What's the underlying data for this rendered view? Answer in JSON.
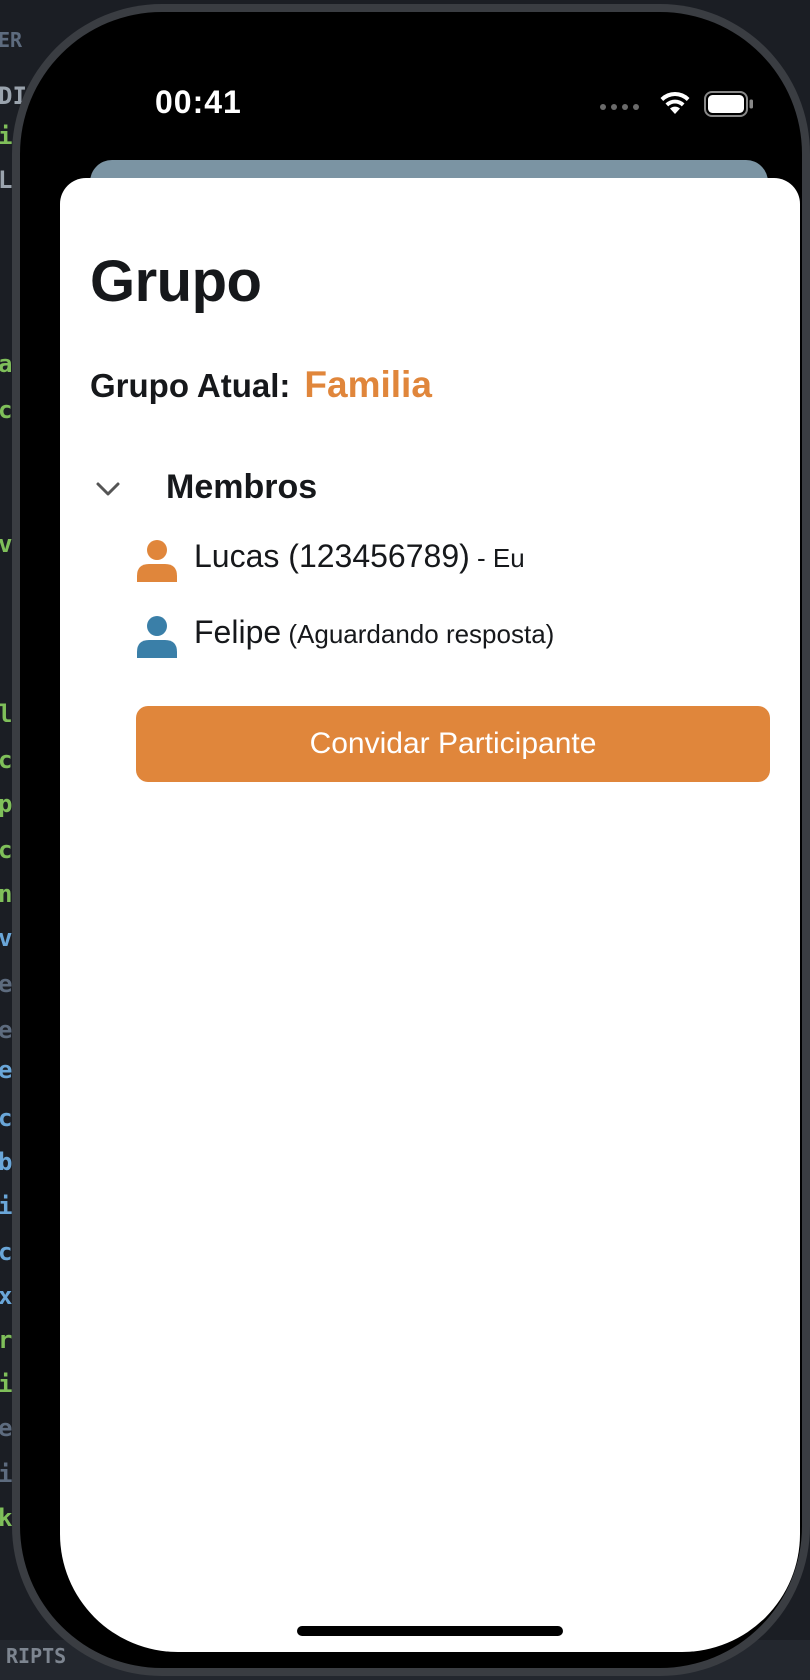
{
  "status_bar": {
    "time": "00:41"
  },
  "sheet": {
    "title": "Grupo",
    "current_group": {
      "label": "Grupo Atual:",
      "value": "Familia"
    },
    "members_section": {
      "label": "Membros",
      "expanded": true,
      "members": [
        {
          "name": "Lucas (123456789)",
          "note": " - Eu",
          "avatar_color": "#e0863b",
          "avatar_icon": "person-icon"
        },
        {
          "name": "Felipe",
          "note": " (Aguardando resposta)",
          "avatar_color": "#3a7fa8",
          "avatar_icon": "person-icon"
        }
      ]
    },
    "invite_button_label": "Convidar Participante"
  },
  "colors": {
    "accent": "#e0863b",
    "pending_member": "#3a7fa8",
    "text": "#16181b",
    "sheet_behind": "#7b94a3"
  }
}
